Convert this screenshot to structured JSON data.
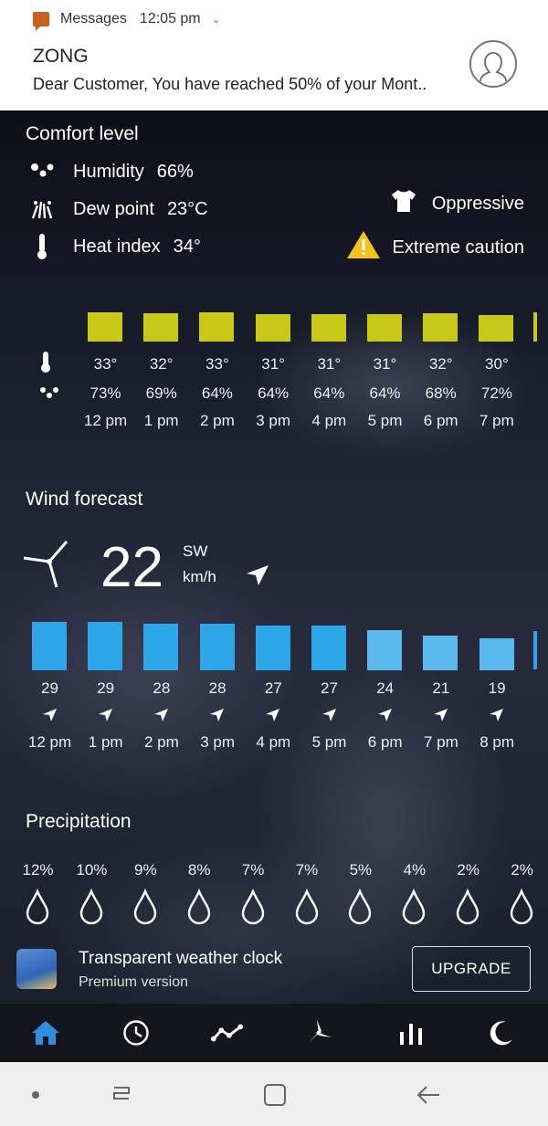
{
  "notification": {
    "app": "Messages",
    "time": "12:05 pm",
    "sender": "ZONG",
    "body": "Dear Customer,  You have reached 50% of your Mont.."
  },
  "comfort": {
    "title": "Comfort level",
    "humidity_label": "Humidity",
    "humidity_value": "66%",
    "dew_label": "Dew point",
    "dew_value": "23°C",
    "heat_label": "Heat index",
    "heat_value": "34°",
    "feel": "Oppressive",
    "warning": "Extreme caution",
    "hours": [
      {
        "temp": "33°",
        "hum": "73%",
        "time": "12 pm",
        "level": 0.8
      },
      {
        "temp": "32°",
        "hum": "69%",
        "time": "1 pm",
        "level": 0.78
      },
      {
        "temp": "33°",
        "hum": "64%",
        "time": "2 pm",
        "level": 0.8
      },
      {
        "temp": "31°",
        "hum": "64%",
        "time": "3 pm",
        "level": 0.75
      },
      {
        "temp": "31°",
        "hum": "64%",
        "time": "4 pm",
        "level": 0.75
      },
      {
        "temp": "31°",
        "hum": "64%",
        "time": "5 pm",
        "level": 0.75
      },
      {
        "temp": "32°",
        "hum": "68%",
        "time": "6 pm",
        "level": 0.78
      },
      {
        "temp": "30°",
        "hum": "72%",
        "time": "7 pm",
        "level": 0.72
      }
    ]
  },
  "wind": {
    "title": "Wind forecast",
    "speed": "22",
    "direction": "SW",
    "unit": "km/h",
    "hours": [
      {
        "speed": "29",
        "time": "12 pm"
      },
      {
        "speed": "29",
        "time": "1 pm"
      },
      {
        "speed": "28",
        "time": "2 pm"
      },
      {
        "speed": "28",
        "time": "3 pm"
      },
      {
        "speed": "27",
        "time": "4 pm"
      },
      {
        "speed": "27",
        "time": "5 pm"
      },
      {
        "speed": "24",
        "time": "6 pm"
      },
      {
        "speed": "21",
        "time": "7 pm"
      },
      {
        "speed": "19",
        "time": "8 pm"
      }
    ]
  },
  "precipitation": {
    "title": "Precipitation",
    "values": [
      "12%",
      "10%",
      "9%",
      "8%",
      "7%",
      "7%",
      "5%",
      "4%",
      "2%",
      "2%"
    ]
  },
  "promo": {
    "title": "Transparent weather clock",
    "subtitle": "Premium version",
    "button": "UPGRADE"
  },
  "colors": {
    "comfort_bar": "#c8c819",
    "wind_bar": "#2ea7ea",
    "active_tab": "#2f8fe0",
    "warning": "#f5c21b",
    "message_icon": "#c9601c"
  },
  "tabs": [
    "home-icon",
    "clock-icon",
    "graph-icon",
    "wind-turbine-icon",
    "bars-icon",
    "moon-icon"
  ]
}
